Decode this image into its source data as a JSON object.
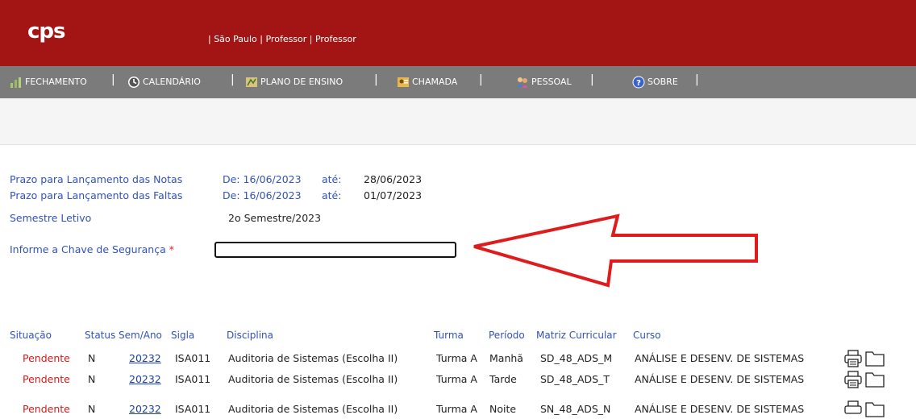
{
  "header": {
    "logo": "cps",
    "info": "| São Paulo | Professor | Professor",
    "bg_color": "#a31515"
  },
  "nav": {
    "items": [
      {
        "label": "FECHAMENTO",
        "icon": "chart-icon"
      },
      {
        "label": "CALENDÁRIO",
        "icon": "clock-icon"
      },
      {
        "label": "PLANO DE ENSINO",
        "icon": "plan-icon"
      },
      {
        "label": "CHAMADA",
        "icon": "attendance-icon"
      },
      {
        "label": "PESSOAL",
        "icon": "people-icon"
      },
      {
        "label": "SOBRE",
        "icon": "info-icon"
      }
    ],
    "separator": "|"
  },
  "form": {
    "prazo_notas_label": "Prazo para Lançamento das Notas",
    "prazo_notas_de": "De: 16/06/2023",
    "prazo_notas_ate_label": "até:",
    "prazo_notas_ate": "28/06/2023",
    "prazo_faltas_label": "Prazo para Lançamento das Faltas",
    "prazo_faltas_de": "De: 16/06/2023",
    "prazo_faltas_ate_label": "até:",
    "prazo_faltas_ate": "01/07/2023",
    "semestre_label": "Semestre Letivo",
    "semestre_value": "2o Semestre/2023",
    "chave_label": "Informe a Chave de Segurança",
    "chave_required": "*",
    "chave_value": ""
  },
  "table": {
    "headers": [
      "Situação",
      "Status",
      "Sem/Ano",
      "Sigla",
      "Disciplina",
      "Turma",
      "Período",
      "Matriz Curricular",
      "Curso"
    ],
    "rows": [
      {
        "situacao": "Pendente",
        "status": "N",
        "semano": "20232",
        "sigla": "ISA011",
        "disciplina": "Auditoria de Sistemas (Escolha II)",
        "turma": "Turma A",
        "periodo": "Manhã",
        "matriz": "SD_48_ADS_M",
        "curso": "ANÁLISE E DESENV. DE SISTEMAS"
      },
      {
        "situacao": "Pendente",
        "status": "N",
        "semano": "20232",
        "sigla": "ISA011",
        "disciplina": "Auditoria de Sistemas (Escolha II)",
        "turma": "Turma A",
        "periodo": "Tarde",
        "matriz": "SD_48_ADS_T",
        "curso": "ANÁLISE E DESENV. DE SISTEMAS"
      },
      {
        "situacao": "Pendente",
        "status": "N",
        "semano": "20232",
        "sigla": "ISA011",
        "disciplina": "Auditoria de Sistemas (Escolha II)",
        "turma": "Turma A",
        "periodo": "Noite",
        "matriz": "SN_48_ADS_N",
        "curso": "ANÁLISE E DESENV. DE SISTEMAS"
      }
    ],
    "row_actions": [
      "printer-icon",
      "folder-icon"
    ]
  },
  "colors": {
    "accent_red": "#a31515",
    "nav_gray": "#7b7b7b",
    "label_blue": "#3152b8",
    "pending_red": "#d01b1b",
    "annotation_arrow": "#e01b1b"
  }
}
